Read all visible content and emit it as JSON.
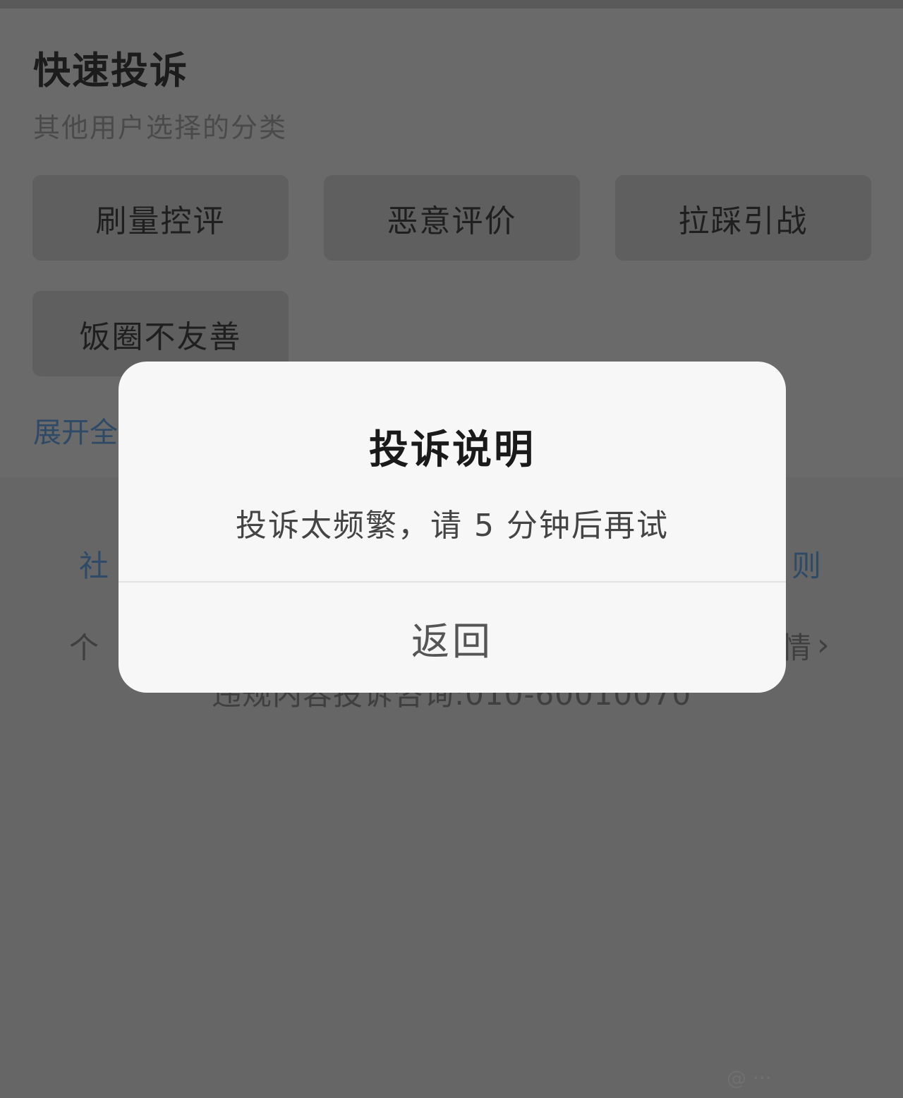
{
  "page": {
    "title": "快速投诉",
    "subtitle": "其他用户选择的分类",
    "categories": [
      "刷量控评",
      "恶意评价",
      "拉踩引战",
      "饭圈不友善"
    ],
    "expand_label": "展开全",
    "lower": {
      "left_link": "社",
      "right_link": "则",
      "left_text": "个",
      "right_text": "情",
      "chevron": "›",
      "phone_line": "违规内容投诉咨询:010-60010070"
    },
    "watermark": "@ ···"
  },
  "dialog": {
    "title": "投诉说明",
    "message": "投诉太频繁，请 5 分钟后再试",
    "button_label": "返回"
  }
}
